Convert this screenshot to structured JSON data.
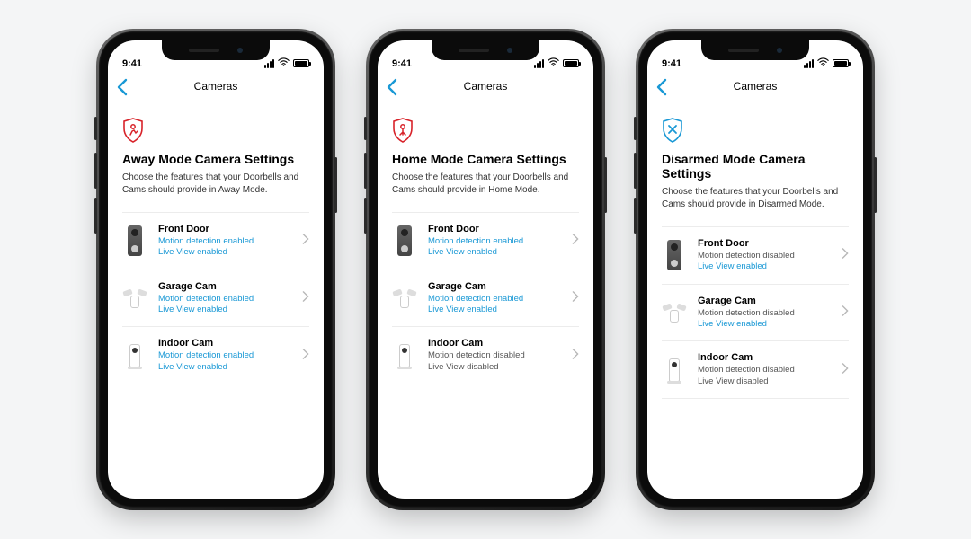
{
  "status": {
    "time": "9:41"
  },
  "nav": {
    "title": "Cameras"
  },
  "colors": {
    "accent": "#1998d5",
    "away": "#d8232a",
    "home": "#d8232a"
  },
  "phones": [
    {
      "mode_icon": "away",
      "mode_color": "#d8232a",
      "heading": "Away Mode Camera Settings",
      "subtext": "Choose the features that your Doorbells and Cams should provide in Away Mode.",
      "devices": [
        {
          "name": "Front Door",
          "thumb": "doorbell",
          "motion": "Motion detection enabled",
          "motion_on": true,
          "live": "Live View enabled",
          "live_on": true
        },
        {
          "name": "Garage Cam",
          "thumb": "floodlight",
          "motion": "Motion detection enabled",
          "motion_on": true,
          "live": "Live View enabled",
          "live_on": true
        },
        {
          "name": "Indoor Cam",
          "thumb": "indoor",
          "motion": "Motion detection enabled",
          "motion_on": true,
          "live": "Live View enabled",
          "live_on": true
        }
      ]
    },
    {
      "mode_icon": "home",
      "mode_color": "#d8232a",
      "heading": "Home Mode Camera Settings",
      "subtext": "Choose the features that your Doorbells and Cams should provide in Home Mode.",
      "devices": [
        {
          "name": "Front Door",
          "thumb": "doorbell",
          "motion": "Motion detection enabled",
          "motion_on": true,
          "live": "Live View enabled",
          "live_on": true
        },
        {
          "name": "Garage Cam",
          "thumb": "floodlight",
          "motion": "Motion detection enabled",
          "motion_on": true,
          "live": "Live View enabled",
          "live_on": true
        },
        {
          "name": "Indoor Cam",
          "thumb": "indoor",
          "motion": "Motion detection disabled",
          "motion_on": false,
          "live": "Live View disabled",
          "live_on": false
        }
      ]
    },
    {
      "mode_icon": "disarmed",
      "mode_color": "#1998d5",
      "heading": "Disarmed Mode Camera Settings",
      "subtext": "Choose the features that your Doorbells and Cams should provide in Disarmed Mode.",
      "devices": [
        {
          "name": "Front Door",
          "thumb": "doorbell",
          "motion": "Motion detection disabled",
          "motion_on": false,
          "live": "Live View enabled",
          "live_on": true
        },
        {
          "name": "Garage Cam",
          "thumb": "floodlight",
          "motion": "Motion detection disabled",
          "motion_on": false,
          "live": "Live View enabled",
          "live_on": true
        },
        {
          "name": "Indoor Cam",
          "thumb": "indoor",
          "motion": "Motion detection disabled",
          "motion_on": false,
          "live": "Live View disabled",
          "live_on": false
        }
      ]
    }
  ]
}
